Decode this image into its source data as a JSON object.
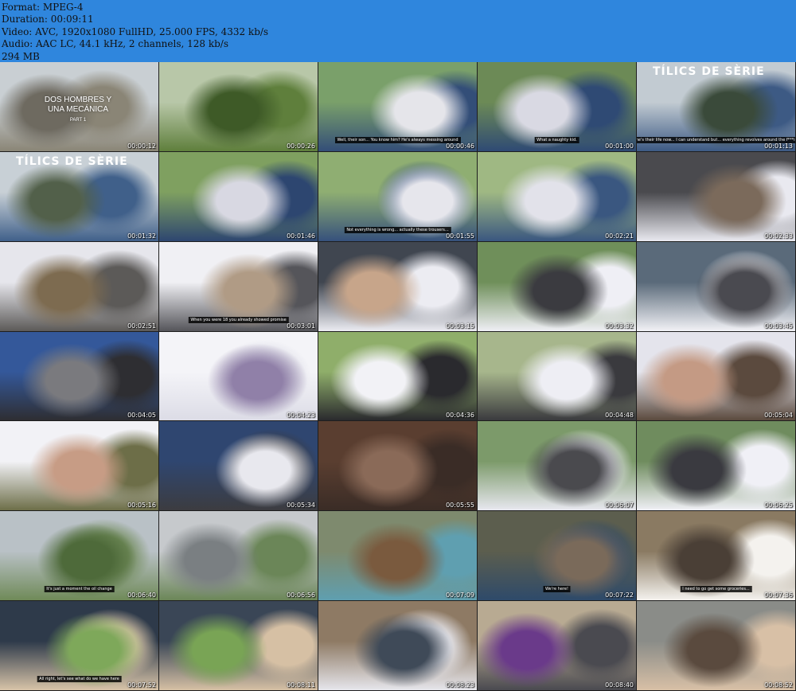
{
  "header": {
    "format": "Format: MPEG-4",
    "duration": "Duration: 00:09:11",
    "video": "Video: AVC, 1920x1080 FullHD, 25.000 FPS, 4332 kb/s",
    "audio": "Audio: AAC LC, 44.1 kHz, 2 channels, 128 kb/s",
    "size": "294 MB"
  },
  "thumbnails": [
    {
      "time": "00:00:12",
      "title": "DOS HOMBRES Y UNA MECÁNICA",
      "part": "PART 1",
      "bg": [
        "#c9cfd3",
        "#8a8576",
        "#6e6a60"
      ]
    },
    {
      "time": "00:00:26",
      "bg": [
        "#b8c7a8",
        "#5f7f3c",
        "#3e5a27"
      ]
    },
    {
      "time": "00:00:46",
      "subtitle": "Well, their son... You know him? He's always messing around",
      "bg": [
        "#7aa06a",
        "#334e78",
        "#e5e5ea"
      ]
    },
    {
      "time": "00:01:00",
      "subtitle": "What a naughty kid.",
      "bg": [
        "#6c8a56",
        "#2f4a74",
        "#d9d9e3"
      ]
    },
    {
      "time": "00:01:13",
      "subtitle": "Well, he's their life now... I can understand but... everything revolves around the f***ing kid",
      "windshield": "TÍLICS DE SÈRIE",
      "bg": [
        "#c2cbd2",
        "#3d5a84",
        "#3a4a3a"
      ]
    },
    {
      "time": "00:01:32",
      "windshield": "TÍLICS DE SÈRIE",
      "bg": [
        "#c8d0d6",
        "#40608a",
        "#52604a"
      ]
    },
    {
      "time": "00:01:46",
      "bg": [
        "#7fa060",
        "#2d4670",
        "#d8d8e2"
      ]
    },
    {
      "time": "00:01:55",
      "subtitle": "Not everything is wrong... actually these trousers...",
      "bg": [
        "#8fae72",
        "#36517c",
        "#e6e6ec"
      ]
    },
    {
      "time": "00:02:21",
      "bg": [
        "#9fb883",
        "#3a5780",
        "#e2e2ea"
      ]
    },
    {
      "time": "00:02:33",
      "bg": [
        "#4a4a4e",
        "#e9e9f0",
        "#7b6a5b"
      ]
    },
    {
      "time": "00:02:51",
      "bg": [
        "#e6e6ec",
        "#5c5a58",
        "#7d6b50"
      ]
    },
    {
      "time": "00:03:01",
      "subtitle": "When you were 18 you already showed promise",
      "bg": [
        "#f0f0f4",
        "#55555a",
        "#b09b85"
      ]
    },
    {
      "time": "00:03:15",
      "bg": [
        "#404650",
        "#ececf2",
        "#c7a58a"
      ]
    },
    {
      "time": "00:03:32",
      "bg": [
        "#6f8f5a",
        "#efeff5",
        "#3b3b40"
      ]
    },
    {
      "time": "00:03:45",
      "bg": [
        "#5a6a7a",
        "#f2f2f6",
        "#4a4a50"
      ]
    },
    {
      "time": "00:04:05",
      "bg": [
        "#34589a",
        "#2e2e32",
        "#7a7a7e"
      ]
    },
    {
      "time": "00:04:23",
      "bg": [
        "#f4f4f8",
        "#dcdce6",
        "#9080a8"
      ]
    },
    {
      "time": "00:04:36",
      "bg": [
        "#8fae6a",
        "#2a2a2e",
        "#f2f2f6"
      ]
    },
    {
      "time": "00:04:48",
      "bg": [
        "#a7b68c",
        "#3a3a3e",
        "#eeeef4"
      ]
    },
    {
      "time": "00:05:04",
      "bg": [
        "#e4e4ec",
        "#5b4a3e",
        "#c49a84"
      ]
    },
    {
      "time": "00:05:16",
      "bg": [
        "#f2f2f6",
        "#6d6e48",
        "#c79c85"
      ]
    },
    {
      "time": "00:05:34",
      "bg": [
        "#2f4670",
        "#3c3c40",
        "#e8e8ee"
      ]
    },
    {
      "time": "00:05:55",
      "bg": [
        "#5a3e30",
        "#3a2c26",
        "#8a6a58"
      ]
    },
    {
      "time": "00:06:07",
      "bg": [
        "#7c9a6a",
        "#e8e8f0",
        "#4a4a4e"
      ]
    },
    {
      "time": "00:06:25",
      "bg": [
        "#6f8c5e",
        "#f0f0f6",
        "#3a3a40"
      ]
    },
    {
      "time": "00:06:40",
      "subtitle": "It's just a moment the oil change",
      "bg": [
        "#b9c1c6",
        "#6f8a58",
        "#4e6a3a"
      ]
    },
    {
      "time": "00:06:56",
      "bg": [
        "#c6c9cc",
        "#6b8658",
        "#7a7f82"
      ]
    },
    {
      "time": "00:07:09",
      "bg": [
        "#7e8a6e",
        "#5f9fb0",
        "#7a5a3e"
      ]
    },
    {
      "time": "00:07:22",
      "subtitle": "We're here!",
      "bg": [
        "#5c5e4e",
        "#2e4a6a",
        "#7a6a5a"
      ]
    },
    {
      "time": "00:07:36",
      "subtitle": "I need to go get some groceries...",
      "bg": [
        "#8a7a62",
        "#f4f2ee",
        "#4a3f36"
      ]
    },
    {
      "time": "00:07:52",
      "subtitle": "All right, let's see what do we have here",
      "bg": [
        "#2e3a4a",
        "#d8c4a8",
        "#7ea85a"
      ]
    },
    {
      "time": "00:08:11",
      "bg": [
        "#3a4656",
        "#d6c0a4",
        "#79a455"
      ]
    },
    {
      "time": "00:08:23",
      "bg": [
        "#8e7a64",
        "#e6e6ec",
        "#3f4a58"
      ]
    },
    {
      "time": "00:08:40",
      "bg": [
        "#b8aa92",
        "#4a4a50",
        "#6a3a8a"
      ]
    },
    {
      "time": "00:08:52",
      "bg": [
        "#8a8c88",
        "#d8c0a6",
        "#5a4a3e"
      ]
    }
  ]
}
